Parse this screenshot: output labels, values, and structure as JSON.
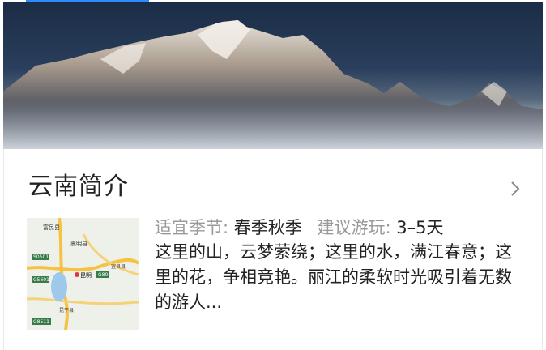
{
  "hero": {
    "image": "snow-mountain-range-photo"
  },
  "intro": {
    "title": "云南简介",
    "season_label": "适宜季节:",
    "season_value": "春季秋季",
    "duration_label": "建议游玩:",
    "duration_value": "3–5天",
    "description": "这里的山，云梦萦绕；这里的水，满江春意；这里的花，争相竞艳。丽江的柔软时光吸引着无数的游人...",
    "more_icon": "chevron-right-icon"
  },
  "map": {
    "labels": [
      "富民县",
      "嵩明县",
      "S0501",
      "G5601",
      "G80",
      "G8511",
      "昆明",
      "宜良县",
      "昆宁县"
    ]
  },
  "colors": {
    "accent": "#2a8cff",
    "label": "#9a9a9a",
    "text": "#222222"
  }
}
